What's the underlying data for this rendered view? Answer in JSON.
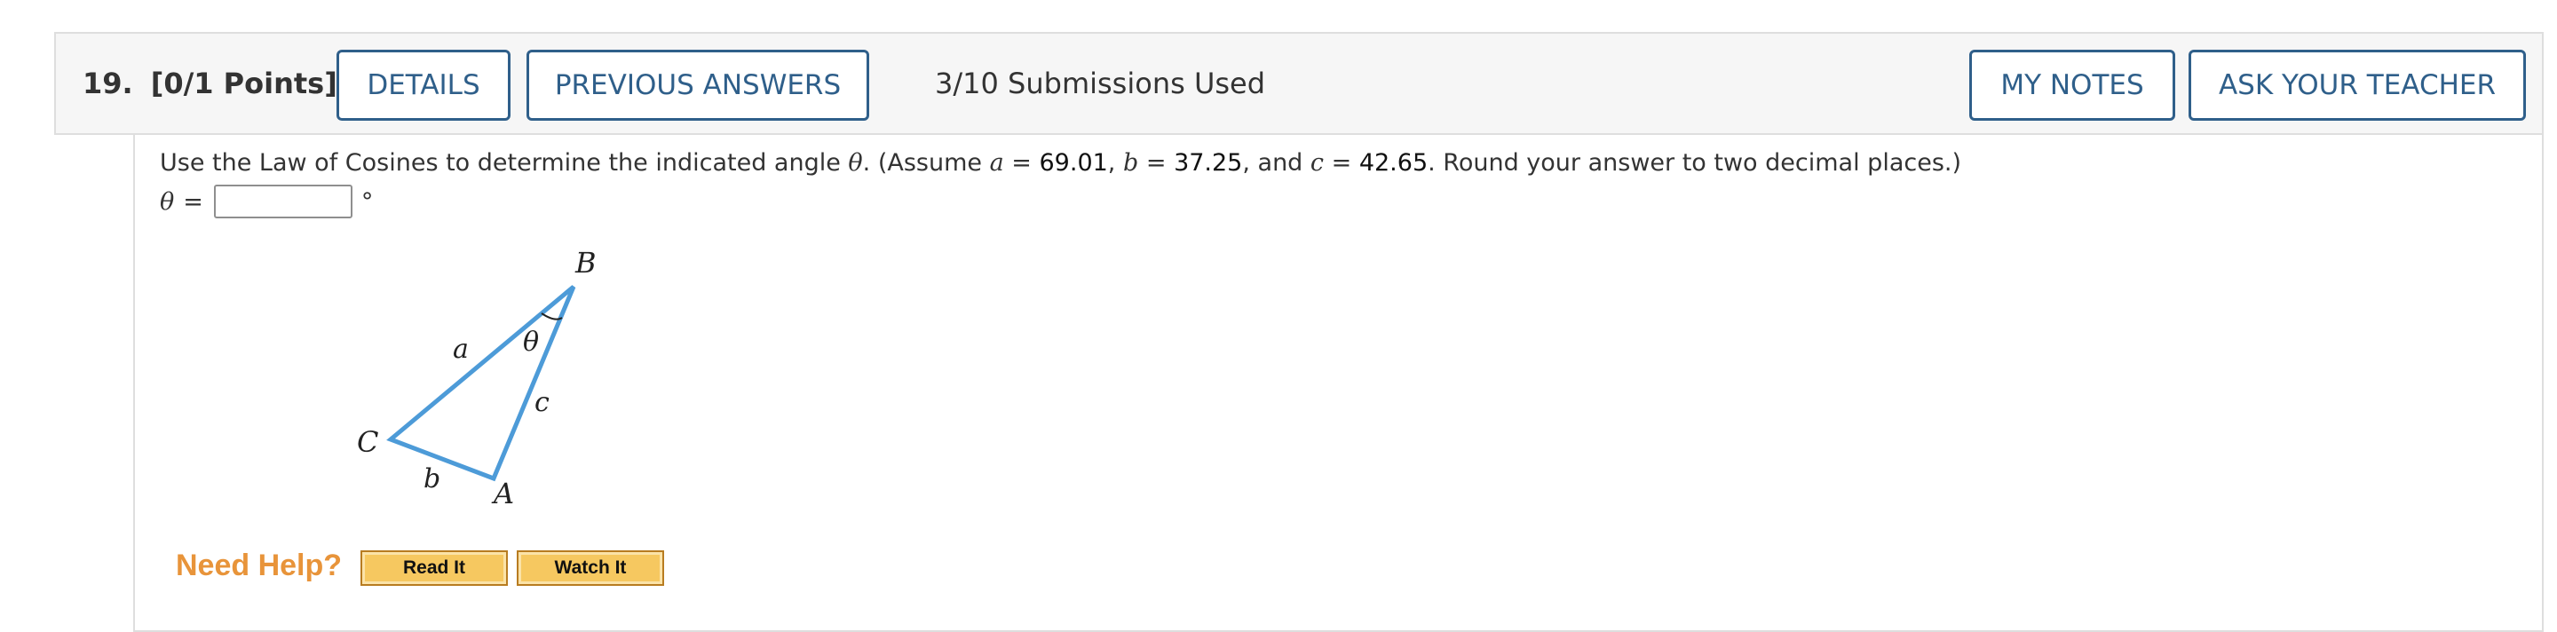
{
  "question": {
    "number": "19.",
    "points": "[0/1 Points]",
    "submissions": "3/10 Submissions Used"
  },
  "buttons": {
    "details": "DETAILS",
    "previous_answers": "PREVIOUS ANSWERS",
    "my_notes": "MY NOTES",
    "ask_teacher": "ASK YOUR TEACHER"
  },
  "prompt": {
    "intro": "Use the Law of Cosines to determine the indicated angle ",
    "theta": "θ",
    "assume": ". (Assume ",
    "a_var": "a",
    "a_val": "69.01",
    "b_var": "b",
    "b_val": "37.25",
    "c_var": "c",
    "c_val": "42.65",
    "ending": ". Round your answer to two decimal places.)"
  },
  "answer": {
    "label": "θ",
    "equals": "=",
    "value": "",
    "unit": "°"
  },
  "figure": {
    "vertex_B": "B",
    "vertex_C": "C",
    "vertex_A": "A",
    "side_a": "a",
    "side_b": "b",
    "side_c": "c",
    "angle": "θ",
    "line_color": "#4d9bd8"
  },
  "help": {
    "label": "Need Help?",
    "read_it": "Read It",
    "watch_it": "Watch It"
  },
  "colors": {
    "button_border": "#2f5f8a",
    "need_help": "#e8943a",
    "help_button": "#f6c860"
  }
}
